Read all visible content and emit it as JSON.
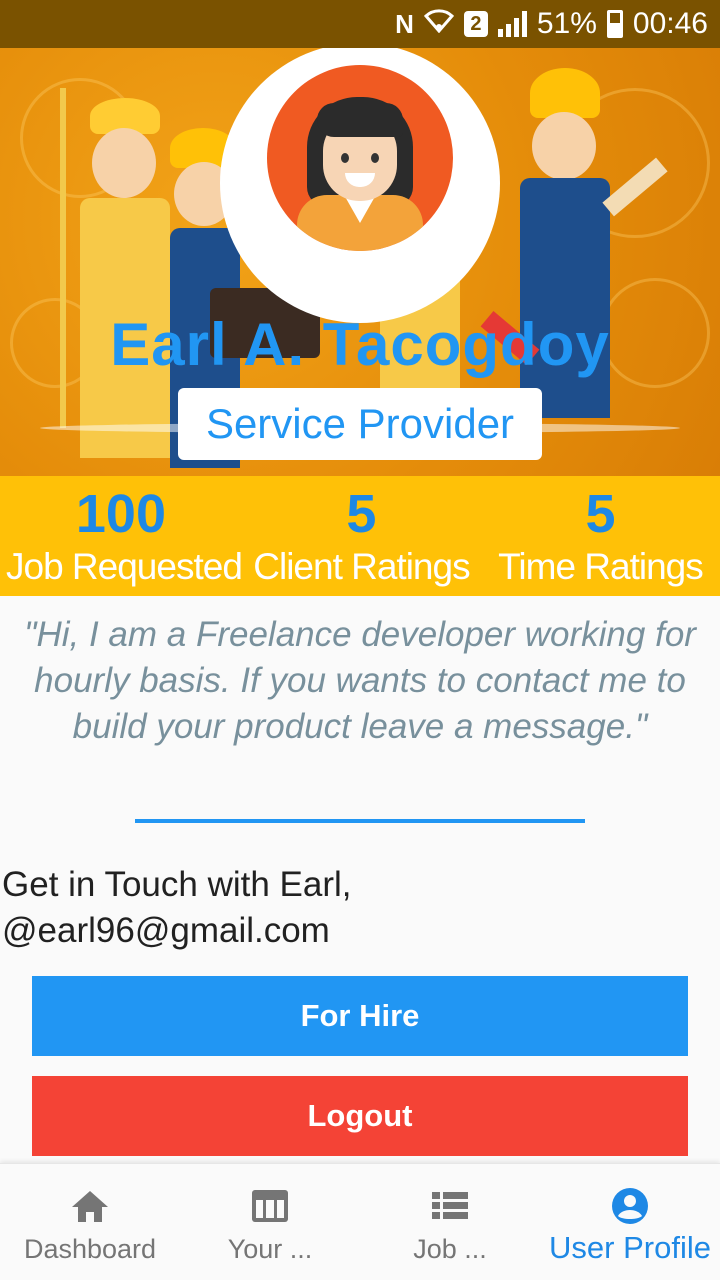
{
  "status_bar": {
    "battery": "51%",
    "time": "00:46",
    "sim_badge": "2",
    "nfc_icon": "nfc-icon"
  },
  "profile": {
    "name": "Earl A. Tacogdoy",
    "role": "Service Provider"
  },
  "stats": [
    {
      "value": "100",
      "label": "Job Requested"
    },
    {
      "value": "5",
      "label": "Client Ratings"
    },
    {
      "value": "5",
      "label": "Time Ratings"
    }
  ],
  "bio": "\"Hi, I am a Freelance developer working for hourly basis. If you wants to contact me to build your product leave a message.\"",
  "contact": {
    "line1": "Get in Touch with Earl,",
    "line2": "@earl96@gmail.com"
  },
  "buttons": {
    "hire": "For Hire",
    "logout": "Logout"
  },
  "bottom_nav": [
    {
      "label": "Dashboard",
      "icon": "home-icon",
      "active": false
    },
    {
      "label": "Your ...",
      "icon": "table-icon",
      "active": false
    },
    {
      "label": "Job ...",
      "icon": "list-icon",
      "active": false
    },
    {
      "label": "User Profile",
      "icon": "account-circle-icon",
      "active": true
    }
  ],
  "colors": {
    "primary": "#2196f3",
    "danger": "#f44336",
    "amber": "#ffc107",
    "banner": "#e58d0a"
  }
}
